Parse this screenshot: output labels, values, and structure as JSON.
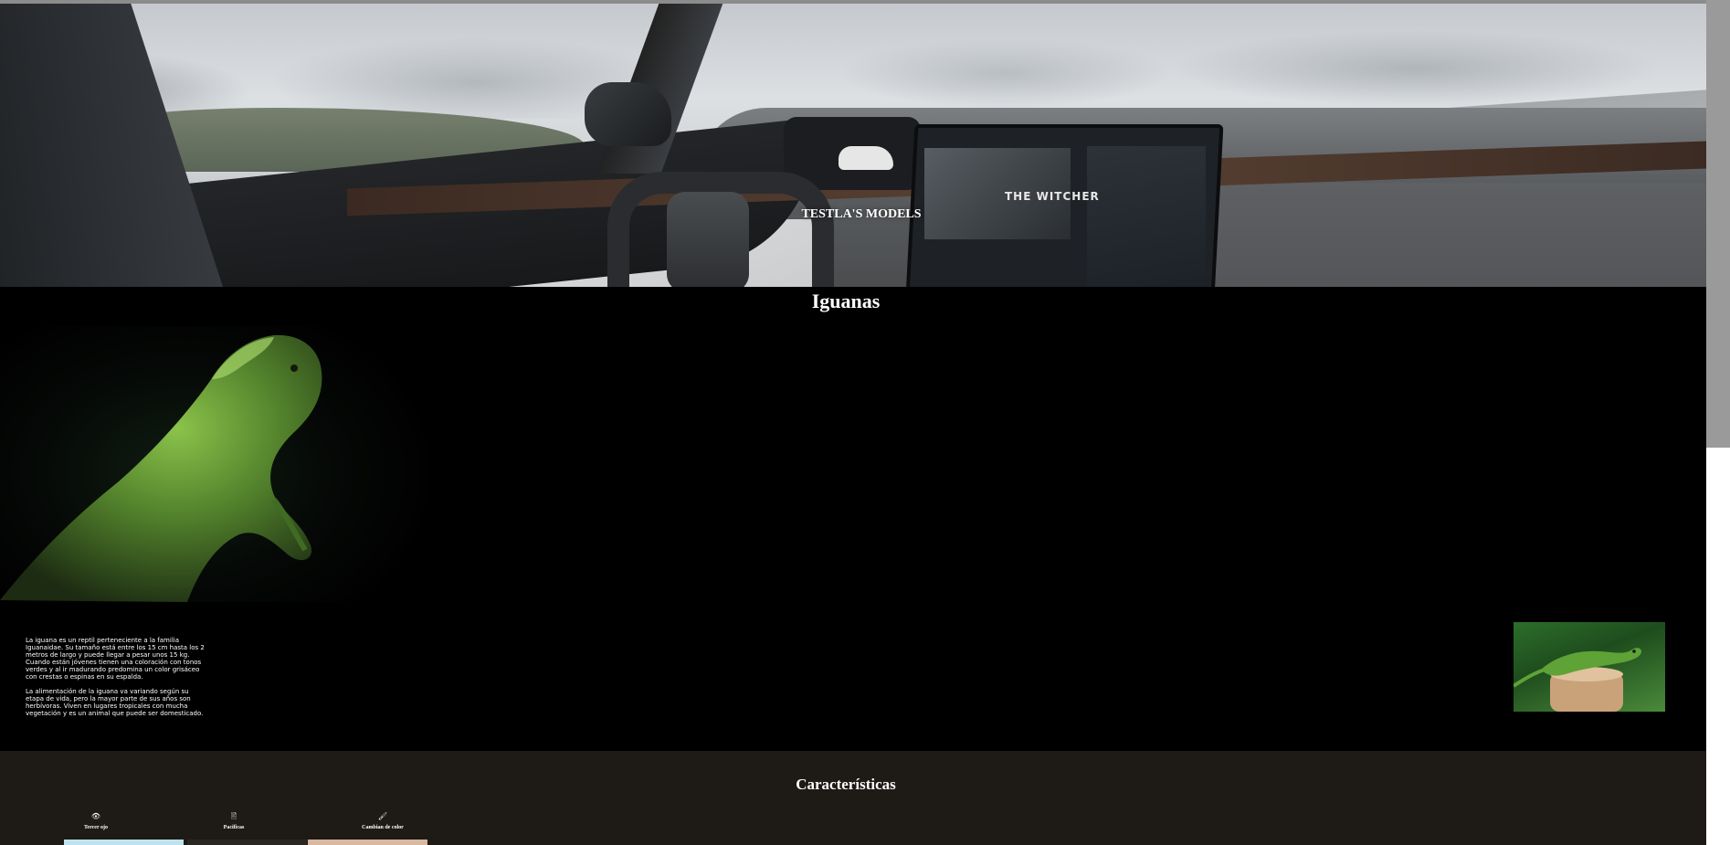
{
  "hero": {
    "title": "TESTLA'S MODELS",
    "screen_game": "THE WITCHER"
  },
  "iguanas": {
    "title": "Iguanas",
    "paragraphs": [
      "La iguana es un reptil perteneciente a la familia Iguanaidae. Su tamaño está entre los 15 cm hasta los 2 metros de largo y puede llegar a pesar unos 15 kg. Cuando están jóvenes tienen una coloración con tonos verdes y al ir madurando predomina un color grisáceo con crestas o espinas en su espalda.",
      "La alimentación de la iguana va variando según su etapa de vida, pero la mayor parte de sus años son herbívoras. Viven en lugares tropicales con mucha vegetación y es un animal que puede ser domesticado."
    ]
  },
  "features": {
    "title": "Características",
    "items": [
      {
        "icon": "eye-icon",
        "glyph": "👁",
        "label": "Tercer ojo",
        "thumb_color": "#bfe3ee"
      },
      {
        "icon": "document-icon",
        "glyph": "🖹",
        "label": "Pacificas",
        "thumb_color": "#2a2622"
      },
      {
        "icon": "brush-icon",
        "glyph": "🖌",
        "label": "Cambian de color",
        "thumb_color": "#d8b8a0"
      }
    ]
  }
}
